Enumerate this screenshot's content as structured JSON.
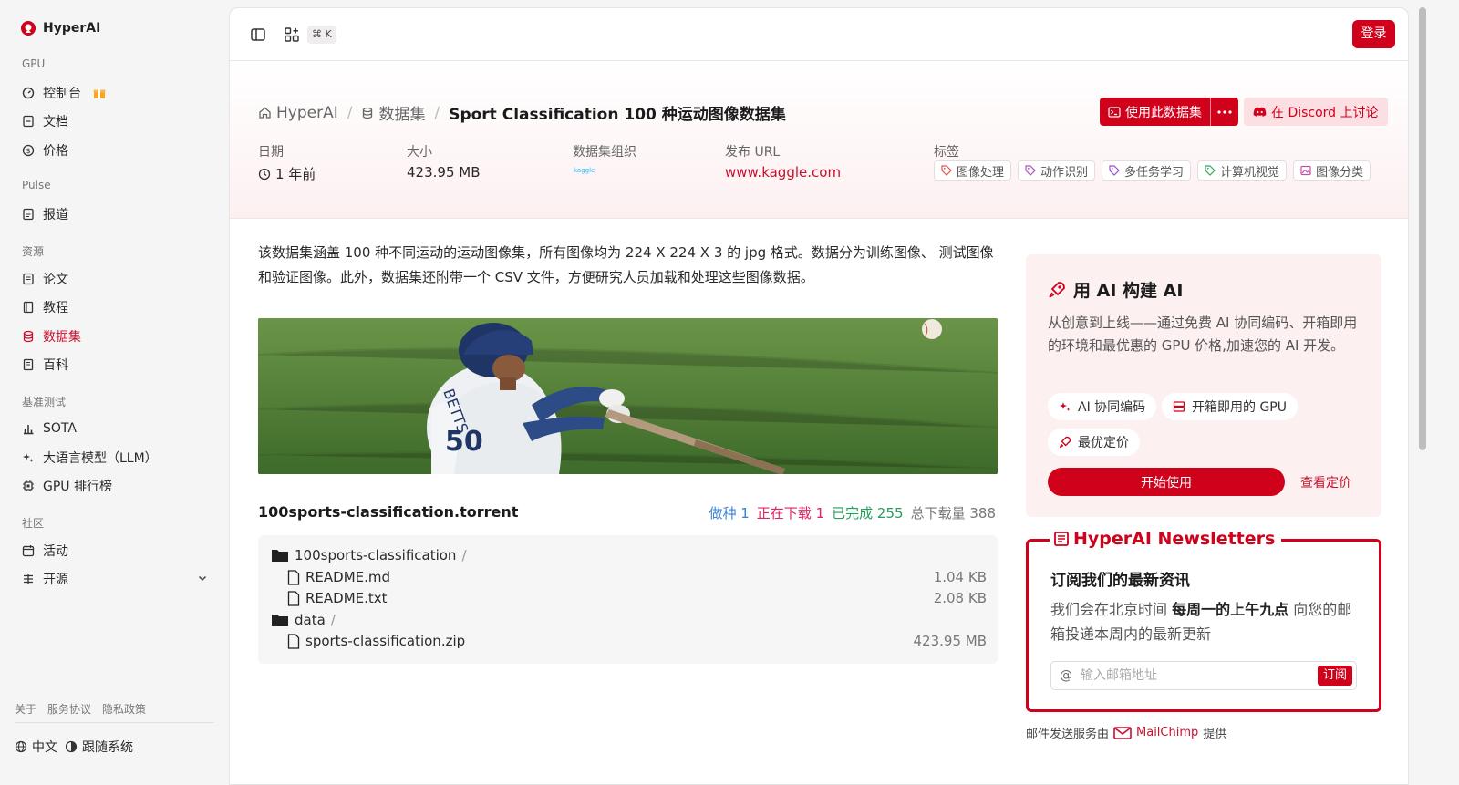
{
  "brand": {
    "name": "HyperAI",
    "accent": "#d0021b"
  },
  "sidebar": {
    "sections": {
      "gpu": "GPU",
      "pulse": "Pulse",
      "resources": "资源",
      "benchmark": "基准测试",
      "community": "社区"
    },
    "items": {
      "console": "控制台",
      "docs": "文档",
      "pricing": "价格",
      "news": "报道",
      "papers": "论文",
      "tutorials": "教程",
      "datasets": "数据集",
      "wiki": "百科",
      "sota": "SOTA",
      "llm": "大语言模型（LLM）",
      "gpu_rank": "GPU 排行榜",
      "events": "活动",
      "opensource": "开源"
    },
    "footer": {
      "about": "关于",
      "terms": "服务协议",
      "privacy": "隐私政策",
      "language": "中文",
      "theme": "跟随系统"
    }
  },
  "topbar": {
    "shortcut": "⌘ K",
    "login": "登录"
  },
  "breadcrumb": {
    "home": "HyperAI",
    "datasets": "数据集",
    "title": "Sport Classification 100 种运动图像数据集"
  },
  "actions": {
    "use_dataset": "使用此数据集",
    "discord": "在 Discord 上讨论"
  },
  "meta": {
    "date_label": "日期",
    "date_value": "1 年前",
    "size_label": "大小",
    "size_value": "423.95 MB",
    "org_label": "数据集组织",
    "org_value": "kaggle",
    "url_label": "发布 URL",
    "url_value": "www.kaggle.com",
    "tags_label": "标签",
    "tags": [
      "图像处理",
      "动作识别",
      "多任务学习",
      "计算机视觉",
      "图像分类"
    ]
  },
  "description": "该数据集涵盖 100 种不同运动的运动图像集，所有图像均为 224 X 224 X 3 的 jpg 格式。数据分为训练图像、 测试图像和验证图像。此外，数据集还附带一个 CSV 文件，方便研究人员加载和处理这些图像数据。",
  "torrent": {
    "name": "100sports-classification.torrent",
    "seeding_label": "做种",
    "seeding": "1",
    "downloading_label": "正在下载",
    "downloading": "1",
    "completed_label": "已完成",
    "completed": "255",
    "total_label": "总下载量",
    "total": "388",
    "files": {
      "folder1": "100sports-classification",
      "readme_md": "README.md",
      "readme_md_size": "1.04 KB",
      "readme_txt": "README.txt",
      "readme_txt_size": "2.08 KB",
      "folder2": "data",
      "zip": "sports-classification.zip",
      "zip_size": "423.95 MB"
    }
  },
  "promo": {
    "title": "用 AI 构建 AI",
    "desc": "从创意到上线——通过免费 AI 协同编码、开箱即用的环境和最优惠的 GPU 价格,加速您的 AI 开发。",
    "pill_code": "AI 协同编码",
    "pill_gpu": "开箱即用的 GPU",
    "pill_price": "最优定价",
    "start": "开始使用",
    "view_pricing": "查看定价"
  },
  "newsletter": {
    "title": "HyperAI Newsletters",
    "subtitle": "订阅我们的最新资讯",
    "desc_pre": "我们会在北京时间 ",
    "desc_bold": "每周一的上午九点",
    "desc_post": " 向您的邮箱投递本周内的最新更新",
    "placeholder": "输入邮箱地址",
    "subscribe": "订阅",
    "powered_pre": "邮件发送服务由",
    "powered_brand": "MailChimp",
    "powered_post": "提供"
  }
}
